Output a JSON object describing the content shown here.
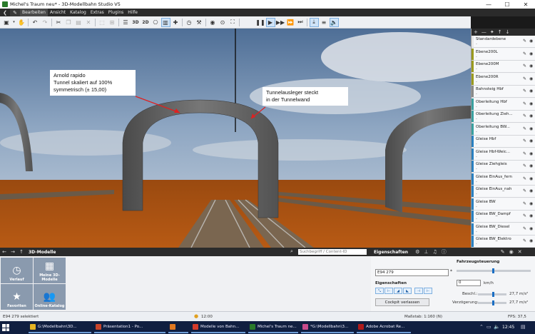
{
  "window": {
    "title": "Michel's Traum neu* - 3D-Modellbahn Studio V5",
    "minimize": "—",
    "maximize": "☐",
    "close": "✕"
  },
  "menu": [
    "Bearbeiten",
    "Ansicht",
    "Katalog",
    "Extras",
    "Plugins",
    "Hilfe"
  ],
  "toolbar": {
    "view_3d": "3D",
    "view_2d": "2D"
  },
  "callouts": {
    "left": [
      "Arnold rapido",
      "Tunnel skaliert auf 100%",
      "symmetrisch (± 15,00)"
    ],
    "right": [
      "Tunnelausleger steckt",
      "in der Tunnelwand"
    ]
  },
  "layer_panel": {
    "buttons": [
      "+",
      "—",
      "✦",
      "↑",
      "↓"
    ],
    "layers": [
      {
        "name": "Standardebene",
        "desc": "-",
        "color": "#e8e8e8"
      },
      {
        "name": "Ebene200L",
        "desc": "-",
        "color": "#9a9a1e"
      },
      {
        "name": "Ebene200M",
        "desc": "-",
        "color": "#9a9a1e"
      },
      {
        "name": "Ebene200R",
        "desc": "-",
        "color": "#9a9a1e"
      },
      {
        "name": "Bahnsteig Hbf",
        "desc": "-",
        "color": "#8a8a8a"
      },
      {
        "name": "Oberleitung Hbf",
        "desc": "-",
        "color": "#3aa0a0"
      },
      {
        "name": "Oberleitung Zieh...",
        "desc": "-",
        "color": "#3aa0a0"
      },
      {
        "name": "Oberleitung BW...",
        "desc": "-",
        "color": "#3aa0a0"
      },
      {
        "name": "Gleise Hbf",
        "desc": "-",
        "color": "#2a80c0"
      },
      {
        "name": "Gleise Hbf-Weic...",
        "desc": "-",
        "color": "#2a80c0"
      },
      {
        "name": "Gleise Ziehgleis",
        "desc": "-",
        "color": "#2a80c0"
      },
      {
        "name": "Gleise EinAus_fern",
        "desc": "-",
        "color": "#2a80c0"
      },
      {
        "name": "Gleise EinAus_nah",
        "desc": "-",
        "color": "#2a80c0"
      },
      {
        "name": "Gleise BW",
        "desc": "-",
        "color": "#2a80c0"
      },
      {
        "name": "Gleise BW_Dampf",
        "desc": "-",
        "color": "#2a80c0"
      },
      {
        "name": "Gleise BW_Diesel",
        "desc": "-",
        "color": "#2a80c0"
      },
      {
        "name": "Gleise BW_Elektro",
        "desc": "-",
        "color": "#2a80c0"
      }
    ]
  },
  "models_panel": {
    "title": "3D-Modelle",
    "search_placeholder": "Suchbegriff / Content-ID",
    "tiles": [
      {
        "label": "Verlauf",
        "icon": "clock-icon"
      },
      {
        "label": "Meine 3D-Modelle",
        "icon": "grid-icon"
      },
      {
        "label": "Favoriten",
        "icon": "star-icon"
      },
      {
        "label": "Online-Katalog",
        "icon": "users-icon"
      }
    ]
  },
  "properties": {
    "title": "Eigenschaften",
    "name_value": "E94 279",
    "required_mark": "*",
    "section_props": "Eigenschaften",
    "cockpit_button": "Cockpit verlassen",
    "section_drive": "Fahrzeugsteuerung",
    "speed_value": "0",
    "speed_unit": "km/h",
    "accel_label": "Beschl.:",
    "accel_value": "27,7 m/s²",
    "decel_label": "Verzögerung:",
    "decel_value": "27,7 m/s²"
  },
  "status": {
    "selection": "E94 279 selektiert",
    "time": "12:00",
    "scale": "Maßstab: 1:160 (N)",
    "fps": "FPS: 37,5"
  },
  "taskbar": {
    "tasks": [
      {
        "label": "G:\\Modellbahn\\3D...",
        "color": "#e6b422"
      },
      {
        "label": "Präsentation1 - Po...",
        "color": "#c8442a"
      },
      {
        "label": "",
        "color": "#e07820"
      },
      {
        "label": "Modelle von Bahn...",
        "color": "#d43a2a"
      },
      {
        "label": "Michel's Traum ne...",
        "color": "#2a7a2a"
      },
      {
        "label": "*G:\\Modellbahn\\3...",
        "color": "#c84a8a"
      },
      {
        "label": "Adobe Acrobat Re...",
        "color": "#b01a1a"
      }
    ],
    "clock": "12:45"
  }
}
